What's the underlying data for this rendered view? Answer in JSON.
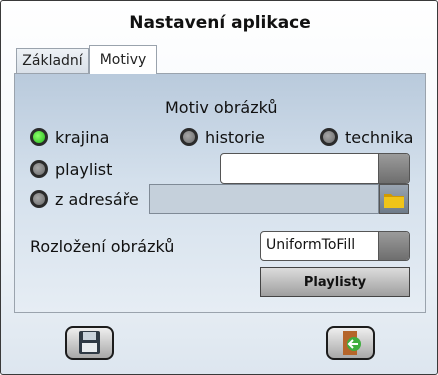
{
  "window": {
    "title": "Nastavení aplikace"
  },
  "tabs": [
    {
      "label": "Základní",
      "active": false
    },
    {
      "label": "Motivy",
      "active": true
    }
  ],
  "motiv": {
    "heading": "Motiv obrázků",
    "options": [
      {
        "label": "krajina",
        "selected": true
      },
      {
        "label": "historie",
        "selected": false
      },
      {
        "label": "technika",
        "selected": false
      },
      {
        "label": "playlist",
        "selected": false
      },
      {
        "label": "z adresáře",
        "selected": false
      }
    ],
    "playlist_value": "",
    "directory_value": ""
  },
  "layout": {
    "label": "Rozložení obrázků",
    "value": "UniformToFill"
  },
  "playlisty_button": "Playlisty",
  "footer": {
    "save_icon": "floppy-disk-icon",
    "exit_icon": "exit-door-icon"
  },
  "colors": {
    "radio_on": "#22b81b",
    "panel_top": "#b9cadc",
    "folder": "#f0c419"
  }
}
